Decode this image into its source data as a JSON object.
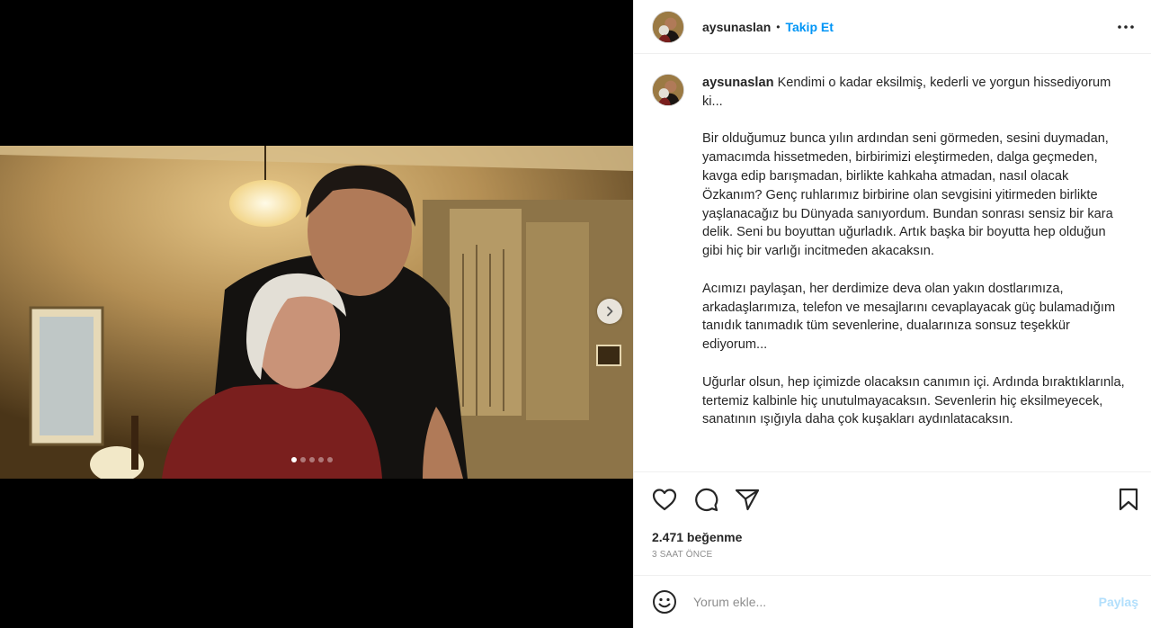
{
  "header": {
    "username": "aysunaslan",
    "separator": "•",
    "follow_label": "Takip Et"
  },
  "media": {
    "image_count": 5,
    "active_index": 0
  },
  "caption": {
    "username": "aysunaslan",
    "paragraphs": [
      "Kendimi o kadar eksilmiş, kederli ve yorgun hissediyorum ki...",
      "Bir olduğumuz bunca yılın ardından seni görmeden, sesini duymadan, yamacımda hissetmeden, birbirimizi eleştirmeden, dalga geçmeden, kavga edip barışmadan, birlikte kahkaha atmadan, nasıl olacak Özkanım? Genç ruhlarımız birbirine olan sevgisini yitirmeden birlikte yaşlanacağız bu Dünyada sanıyordum. Bundan sonrası sensiz bir kara delik. Seni bu boyuttan uğurladık. Artık başka bir boyutta hep olduğun gibi hiç bir varlığı incitmeden akacaksın.",
      "Acımızı paylaşan, her derdimize deva olan yakın dostlarımıza, arkadaşlarımıza, telefon ve mesajlarını cevaplayacak güç bulamadığım tanıdık tanımadık tüm sevenlerine, dualarınıza sonsuz teşekkür ediyorum...",
      "Uğurlar olsun, hep içimizde olacaksın canımın içi. Ardında bıraktıklarınla, tertemiz kalbinle hiç unutulmayacaksın. Sevenlerin hiç eksilmeyecek, sanatının ışığıyla daha çok kuşakları aydınlatacaksın."
    ]
  },
  "stats": {
    "likes": "2.471 beğenme",
    "time": "3 SAAT ÖNCE"
  },
  "comment": {
    "placeholder": "Yorum ekle...",
    "share_label": "Paylaş"
  },
  "icons": {
    "like": "heart-icon",
    "comment": "comment-icon",
    "share": "paper-plane-icon",
    "save": "bookmark-icon",
    "more": "more-dots-icon",
    "emoji": "emoji-icon",
    "next": "chevron-right-icon"
  },
  "colors": {
    "accent": "#0095f6",
    "share_disabled": "#b2dffc",
    "muted": "#8e8e8e",
    "text": "#262626"
  }
}
